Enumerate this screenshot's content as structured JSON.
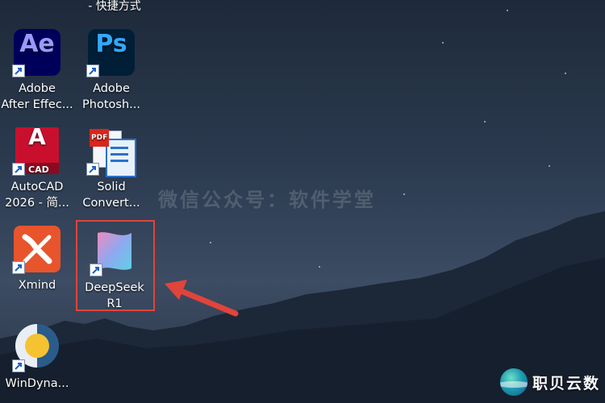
{
  "top_partial_label": "- 快捷方式",
  "icons": [
    {
      "name": "Adobe\nAfter Effec...",
      "app": "after-effects",
      "abbr": "Ae"
    },
    {
      "name": "Adobe\nPhotosh...",
      "app": "photoshop",
      "abbr": "Ps"
    },
    {
      "name": "AutoCAD\n2026 - 简...",
      "app": "autocad",
      "abbr": "A",
      "sub": "CAD"
    },
    {
      "name": "Solid\nConvert...",
      "app": "solid-converter",
      "badge": "PDF"
    },
    {
      "name": "Xmind",
      "app": "xmind"
    },
    {
      "name": "DeepSeek\nR1",
      "app": "deepseek"
    },
    {
      "name": "WinDyna...",
      "app": "windynamicdesktop"
    }
  ],
  "watermark": "微信公众号：软件学堂",
  "brand_logo": "职贝云数",
  "colors": {
    "highlight": "#e0443a",
    "ae_bg": "#00005b",
    "ae_fg": "#9999ff",
    "ps_bg": "#001e36",
    "ps_fg": "#31a8ff",
    "cad_bg": "#c8102e"
  }
}
